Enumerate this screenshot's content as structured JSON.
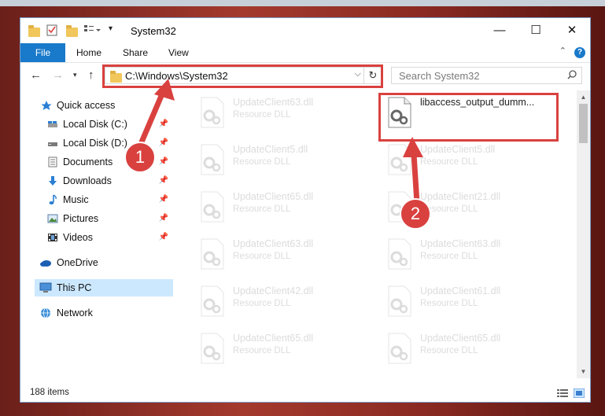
{
  "window": {
    "title": "System32",
    "controls": {
      "minimize": "—",
      "maximize": "☐",
      "close": "✕"
    }
  },
  "ribbon": {
    "file_label": "File",
    "tabs": [
      "Home",
      "Share",
      "View"
    ],
    "help": "?"
  },
  "address": {
    "path": "C:\\Windows\\System32",
    "search_placeholder": "Search System32"
  },
  "nav": {
    "items": [
      {
        "label": "Quick access",
        "icon": "star-icon",
        "pinned": false
      },
      {
        "label": "Local Disk (C:)",
        "icon": "drive-icon",
        "pinned": true
      },
      {
        "label": "Local Disk (D:)",
        "icon": "drive-icon",
        "pinned": true
      },
      {
        "label": "Documents",
        "icon": "document-icon",
        "pinned": true
      },
      {
        "label": "Downloads",
        "icon": "download-icon",
        "pinned": true
      },
      {
        "label": "Music",
        "icon": "music-icon",
        "pinned": true
      },
      {
        "label": "Pictures",
        "icon": "picture-icon",
        "pinned": true
      },
      {
        "label": "Videos",
        "icon": "video-icon",
        "pinned": true
      },
      {
        "label": "OneDrive",
        "icon": "cloud-icon",
        "pinned": false
      },
      {
        "label": "This PC",
        "icon": "computer-icon",
        "pinned": false
      },
      {
        "label": "Network",
        "icon": "network-icon",
        "pinned": false
      }
    ]
  },
  "files": {
    "left_column": [
      {
        "name": "UpdateClient63.dll",
        "type": "Resource DLL"
      },
      {
        "name": "UpdateClient5.dll",
        "type": "Resource DLL"
      },
      {
        "name": "UpdateClient65.dll",
        "type": "Resource DLL"
      },
      {
        "name": "UpdateClient63.dll",
        "type": "Resource DLL"
      },
      {
        "name": "UpdateClient42.dll",
        "type": "Resource DLL"
      },
      {
        "name": "UpdateClient65.dll",
        "type": "Resource DLL"
      }
    ],
    "right_column": [
      {
        "name": "libaccess_output_dumm...",
        "type": "",
        "highlighted": true
      },
      {
        "name": "UpdateClient5.dll",
        "type": "Resource DLL"
      },
      {
        "name": "UpdateClient21.dll",
        "type": "Resource DLL"
      },
      {
        "name": "UpdateClient63.dll",
        "type": "Resource DLL"
      },
      {
        "name": "UpdateClient61.dll",
        "type": "Resource DLL"
      },
      {
        "name": "UpdateClient65.dll",
        "type": "Resource DLL"
      }
    ]
  },
  "status": {
    "item_count": "188 items"
  },
  "annotations": {
    "step1": "1",
    "step2": "2",
    "accent": "#d9413f"
  }
}
